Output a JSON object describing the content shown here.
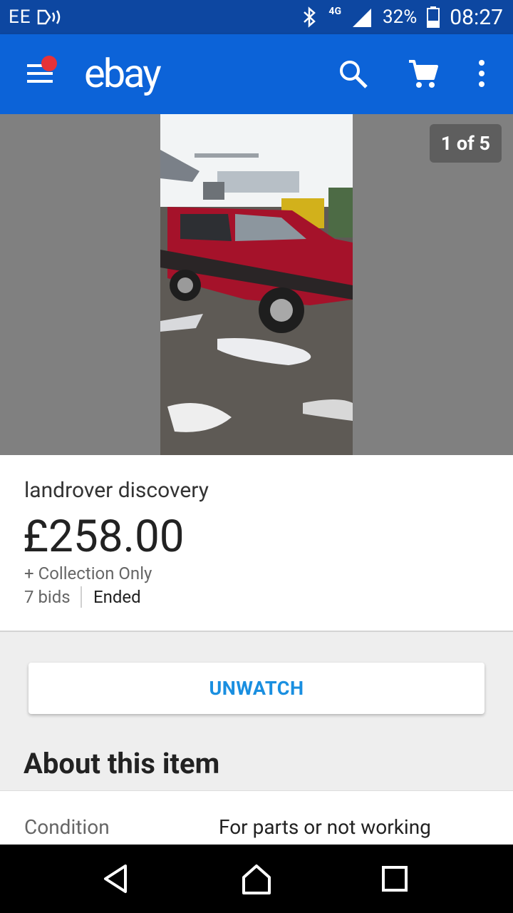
{
  "status_bar": {
    "carrier": "EE",
    "network": "4G",
    "battery": "32%",
    "time": "08:27"
  },
  "app_bar": {
    "logo": "ebay",
    "icons": [
      "menu-icon",
      "search-icon",
      "cart-icon",
      "more-vert-icon"
    ]
  },
  "gallery": {
    "counter": "1 of 5"
  },
  "item": {
    "title": "landrover discovery",
    "price": "£258.00",
    "shipping": "+ Collection Only",
    "bids": "7 bids",
    "status": "Ended"
  },
  "actions": {
    "unwatch_label": "UNWATCH"
  },
  "about": {
    "heading": "About this item",
    "condition_label": "Condition",
    "condition_value": "For parts or not working"
  },
  "colors": {
    "status_bar": "#0d47a1",
    "app_bar": "#0c63d8",
    "accent": "#1a8fe0",
    "notification_dot": "#e53238"
  }
}
